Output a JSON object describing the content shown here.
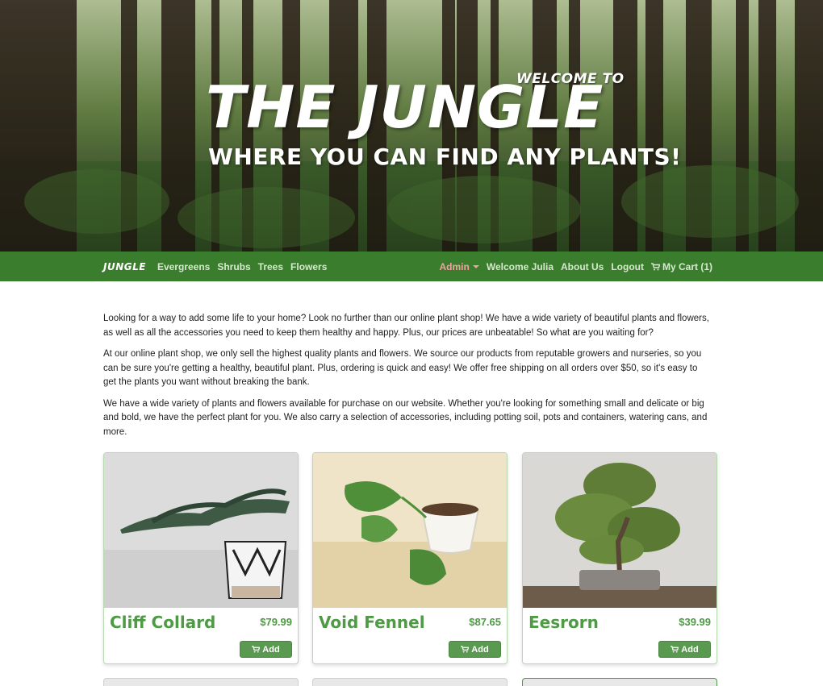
{
  "hero": {
    "welcome": "WELCOME TO",
    "title": "THE JUNGLE",
    "subtitle": "WHERE YOU CAN FIND ANY PLANTS!"
  },
  "nav": {
    "brand": "JUNGLE",
    "left_links": [
      "Evergreens",
      "Shrubs",
      "Trees",
      "Flowers"
    ],
    "admin": "Admin",
    "welcome": "Welcome Julia",
    "about": "About Us",
    "logout": "Logout",
    "cart": "My Cart (1)"
  },
  "intro": [
    "Looking for a way to add some life to your home? Look no further than our online plant shop! We have a wide variety of beautiful plants and flowers, as well as all the accessories you need to keep them healthy and happy. Plus, our prices are unbeatable! So what are you waiting for?",
    "At our online plant shop, we only sell the highest quality plants and flowers. We source our products from reputable growers and nurseries, so you can be sure you're getting a healthy, beautiful plant. Plus, ordering is quick and easy! We offer free shipping on all orders over $50, so it's easy to get the plants you want without breaking the bank.",
    "We have a wide variety of plants and flowers available for purchase on our website. Whether you're looking for something small and delicate or big and bold, we have the perfect plant for you. We also carry a selection of accessories, including potting soil, pots and containers, watering cans, and more."
  ],
  "products": [
    {
      "name": "Cliff Collard",
      "price": "$79.99",
      "button": "Add"
    },
    {
      "name": "Void Fennel",
      "price": "$87.65",
      "button": "Add"
    },
    {
      "name": "Eesrorn",
      "price": "$39.99",
      "button": "Add"
    }
  ],
  "colors": {
    "nav": "#3a7d2c",
    "accent": "#4e9a45",
    "button": "#5a9a50",
    "admin": "#f0a2a2"
  }
}
